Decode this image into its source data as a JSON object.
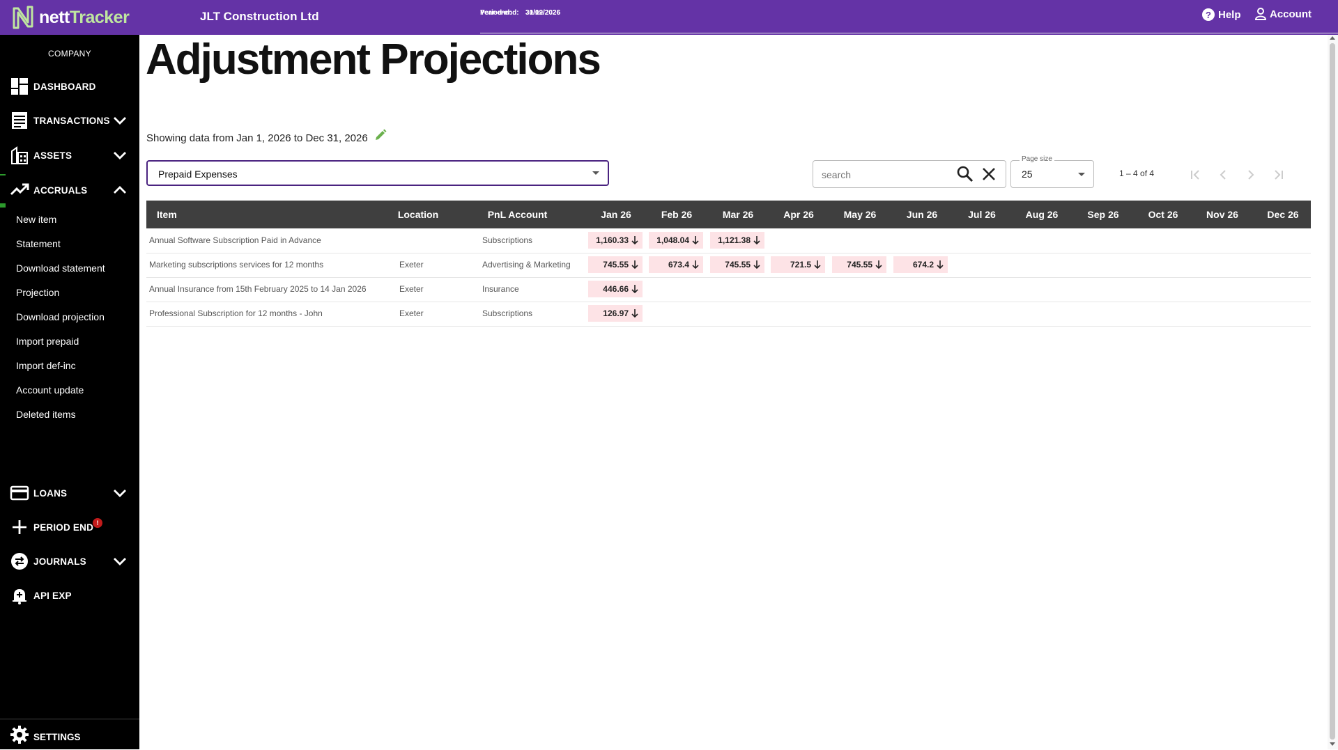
{
  "header": {
    "logo_word1": "nett",
    "logo_word2": "Tracker",
    "company": "JLT Construction Ltd",
    "year_end_label": "Year-end:",
    "year_end_value": "31/12/2026",
    "period_end_label": "Period-end:",
    "period_end_value": "30/09/2026",
    "help": "Help",
    "account": "Account"
  },
  "sidebar": {
    "company_label": "COMPANY",
    "dashboard": "DASHBOARD",
    "transactions": "TRANSACTIONS",
    "assets": "ASSETS",
    "accruals": "ACCRUALS",
    "accruals_sub": [
      "New item",
      "Statement",
      "Download statement",
      "Projection",
      "Download projection",
      "Import prepaid",
      "Import def-inc",
      "Account update",
      "Deleted items"
    ],
    "loans": "LOANS",
    "period_end": "PERIOD END",
    "period_end_badge": "!",
    "journals": "JOURNALS",
    "api_exp": "API EXP",
    "settings": "SETTINGS"
  },
  "main": {
    "title": "Adjustment Projections",
    "date_range": "Showing data from Jan 1, 2026 to Dec 31, 2026",
    "category_selected": "Prepaid Expenses",
    "search_placeholder": "search",
    "page_size_label": "Page size",
    "page_size_value": "25",
    "range_label": "1 – 4 of 4"
  },
  "table": {
    "columns": [
      "Item",
      "Location",
      "PnL Account",
      "Jan 26",
      "Feb 26",
      "Mar 26",
      "Apr 26",
      "May 26",
      "Jun 26",
      "Jul 26",
      "Aug 26",
      "Sep 26",
      "Oct 26",
      "Nov 26",
      "Dec 26"
    ],
    "rows": [
      {
        "item": "Annual Software Subscription Paid in Advance",
        "location": "",
        "pnl": "Subscriptions",
        "amounts": [
          "1,160.33",
          "1,048.04",
          "1,121.38",
          "",
          "",
          "",
          "",
          "",
          "",
          "",
          "",
          ""
        ]
      },
      {
        "item": "Marketing subscriptions services for 12 months",
        "location": "Exeter",
        "pnl": "Advertising & Marketing",
        "amounts": [
          "745.55",
          "673.4",
          "745.55",
          "721.5",
          "745.55",
          "674.2",
          "",
          "",
          "",
          "",
          "",
          ""
        ]
      },
      {
        "item": "Annual Insurance from 15th February 2025 to 14 Jan 2026",
        "location": "Exeter",
        "pnl": "Insurance",
        "amounts": [
          "446.66",
          "",
          "",
          "",
          "",
          "",
          "",
          "",
          "",
          "",
          "",
          ""
        ]
      },
      {
        "item": "Professional Subscription for 12 months - John",
        "location": "Exeter",
        "pnl": "Subscriptions",
        "amounts": [
          "126.97",
          "",
          "",
          "",
          "",
          "",
          "",
          "",
          "",
          "",
          "",
          ""
        ]
      }
    ]
  },
  "colors": {
    "topbar": "#6433a6",
    "sidebar": "#000000",
    "accent_green": "#2c9a2c",
    "amount_bg": "#fde3e6",
    "table_header": "#3f3f3f"
  }
}
